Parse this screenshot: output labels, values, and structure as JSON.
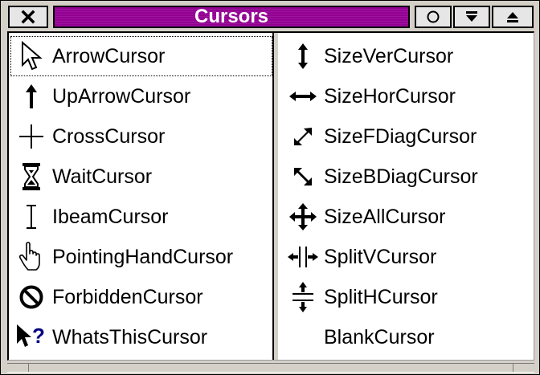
{
  "window": {
    "title": "Cursors"
  },
  "titlebar": {
    "close_icon": "close-icon",
    "circle_icon": "circle-icon",
    "down_icon": "triangle-down-icon",
    "up_icon": "triangle-up-icon"
  },
  "left_list": [
    {
      "label": "ArrowCursor",
      "icon": "arrow-cursor-icon"
    },
    {
      "label": "UpArrowCursor",
      "icon": "up-arrow-cursor-icon"
    },
    {
      "label": "CrossCursor",
      "icon": "cross-cursor-icon"
    },
    {
      "label": "WaitCursor",
      "icon": "hourglass-cursor-icon"
    },
    {
      "label": "IbeamCursor",
      "icon": "ibeam-cursor-icon"
    },
    {
      "label": "PointingHandCursor",
      "icon": "pointing-hand-cursor-icon"
    },
    {
      "label": "ForbiddenCursor",
      "icon": "forbidden-cursor-icon"
    },
    {
      "label": "WhatsThisCursor",
      "icon": "whats-this-cursor-icon"
    }
  ],
  "right_list": [
    {
      "label": "SizeVerCursor",
      "icon": "size-vertical-cursor-icon"
    },
    {
      "label": "SizeHorCursor",
      "icon": "size-horizontal-cursor-icon"
    },
    {
      "label": "SizeFDiagCursor",
      "icon": "size-fdiag-cursor-icon"
    },
    {
      "label": "SizeBDiagCursor",
      "icon": "size-bdiag-cursor-icon"
    },
    {
      "label": "SizeAllCursor",
      "icon": "size-all-cursor-icon"
    },
    {
      "label": "SplitVCursor",
      "icon": "split-v-cursor-icon"
    },
    {
      "label": "SplitHCursor",
      "icon": "split-h-cursor-icon"
    },
    {
      "label": "BlankCursor",
      "icon": "blank-cursor-icon"
    }
  ],
  "colors": {
    "title_bar": "#930093",
    "background": "#d4d0c8",
    "list_background": "#ffffff",
    "question_mark": "#000080"
  }
}
